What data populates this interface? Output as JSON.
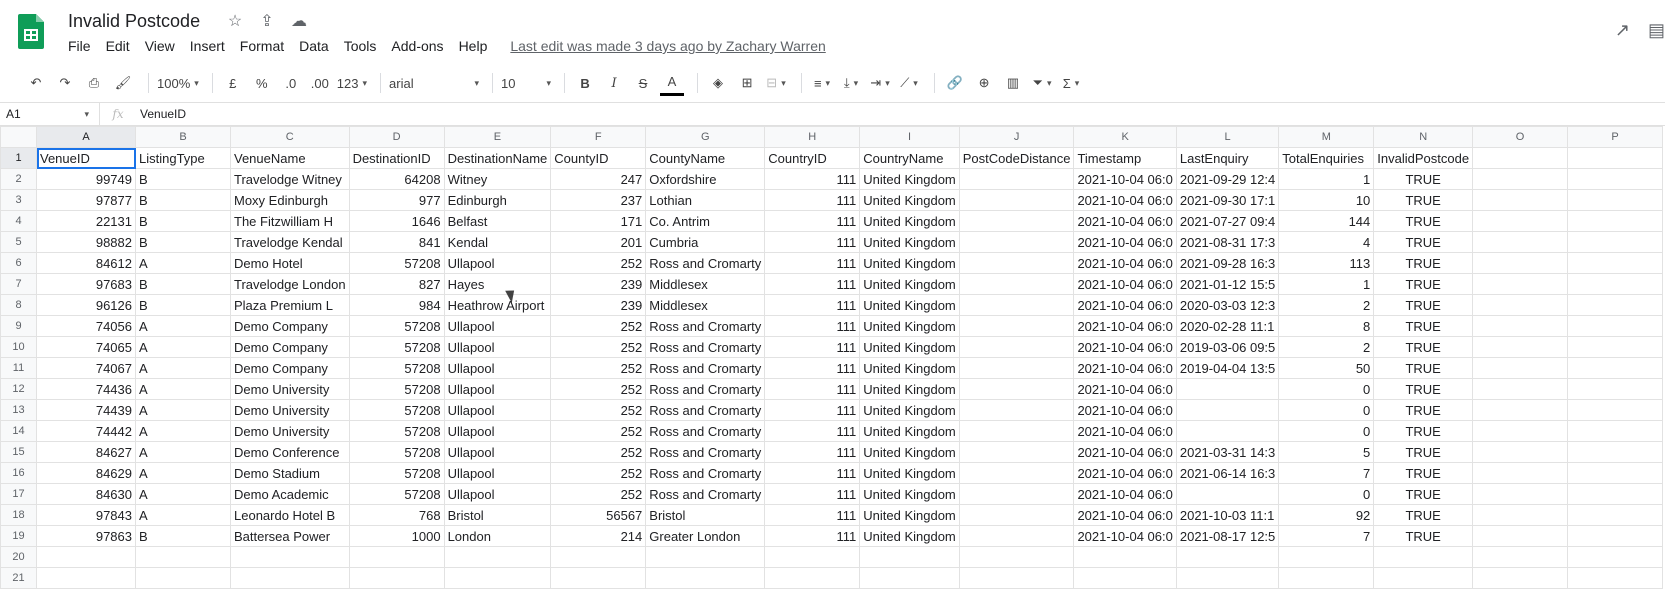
{
  "doc": {
    "title": "Invalid Postcode"
  },
  "menu": {
    "items": [
      "File",
      "Edit",
      "View",
      "Insert",
      "Format",
      "Data",
      "Tools",
      "Add-ons",
      "Help"
    ],
    "last_edit": "Last edit was made 3 days ago by Zachary Warren"
  },
  "toolbar": {
    "zoom": "100%",
    "currency": "£",
    "percent": "%",
    "dec_dec": ".0",
    "dec_inc": ".00",
    "more_formats": "123",
    "font": "arial",
    "font_size": "10"
  },
  "formula_bar": {
    "cell_ref": "A1",
    "value": "VenueID"
  },
  "colors": {
    "brand_green": "#0f9d58",
    "selection": "#1a73e8"
  },
  "sheet": {
    "columns": [
      "A",
      "B",
      "C",
      "D",
      "E",
      "F",
      "G",
      "H",
      "I",
      "J",
      "K",
      "L",
      "M",
      "N",
      "O",
      "P"
    ],
    "row_numbers": [
      "1",
      "2",
      "3",
      "4",
      "5",
      "6",
      "7",
      "8",
      "9",
      "10",
      "11",
      "12",
      "13",
      "14",
      "15",
      "16",
      "17",
      "18",
      "19",
      "20",
      "21"
    ],
    "header": [
      "VenueID",
      "ListingType",
      "VenueName",
      "DestinationID",
      "DestinationName",
      "CountyID",
      "CountyName",
      "CountryID",
      "CountryName",
      "PostCodeDistance",
      "Timestamp",
      "LastEnquiry",
      "TotalEnquiries",
      "InvalidPostcode",
      "",
      ""
    ],
    "rows": [
      [
        "99749",
        "B",
        "Travelodge Witney",
        "64208",
        "Witney",
        "247",
        "Oxfordshire",
        "111",
        "United Kingdom",
        "",
        "2021-10-04 06:0",
        "2021-09-29 12:4",
        "1",
        "TRUE",
        "",
        ""
      ],
      [
        "97877",
        "B",
        "Moxy Edinburgh",
        "977",
        "Edinburgh",
        "237",
        "Lothian",
        "111",
        "United Kingdom",
        "",
        "2021-10-04 06:0",
        "2021-09-30 17:1",
        "10",
        "TRUE",
        "",
        ""
      ],
      [
        "22131",
        "B",
        "The Fitzwilliam H",
        "1646",
        "Belfast",
        "171",
        "Co. Antrim",
        "111",
        "United Kingdom",
        "",
        "2021-10-04 06:0",
        "2021-07-27 09:4",
        "144",
        "TRUE",
        "",
        ""
      ],
      [
        "98882",
        "B",
        "Travelodge Kendal",
        "841",
        "Kendal",
        "201",
        "Cumbria",
        "111",
        "United Kingdom",
        "",
        "2021-10-04 06:0",
        "2021-08-31 17:3",
        "4",
        "TRUE",
        "",
        ""
      ],
      [
        "84612",
        "A",
        "Demo Hotel",
        "57208",
        "Ullapool",
        "252",
        "Ross and Cromarty",
        "111",
        "United Kingdom",
        "",
        "2021-10-04 06:0",
        "2021-09-28 16:3",
        "113",
        "TRUE",
        "",
        ""
      ],
      [
        "97683",
        "B",
        "Travelodge London",
        "827",
        "Hayes",
        "239",
        "Middlesex",
        "111",
        "United Kingdom",
        "",
        "2021-10-04 06:0",
        "2021-01-12 15:5",
        "1",
        "TRUE",
        "",
        ""
      ],
      [
        "96126",
        "B",
        "Plaza Premium L",
        "984",
        "Heathrow Airport",
        "239",
        "Middlesex",
        "111",
        "United Kingdom",
        "",
        "2021-10-04 06:0",
        "2020-03-03 12:3",
        "2",
        "TRUE",
        "",
        ""
      ],
      [
        "74056",
        "A",
        "Demo Company",
        "57208",
        "Ullapool",
        "252",
        "Ross and Cromarty",
        "111",
        "United Kingdom",
        "",
        "2021-10-04 06:0",
        "2020-02-28 11:1",
        "8",
        "TRUE",
        "",
        ""
      ],
      [
        "74065",
        "A",
        "Demo Company",
        "57208",
        "Ullapool",
        "252",
        "Ross and Cromarty",
        "111",
        "United Kingdom",
        "",
        "2021-10-04 06:0",
        "2019-03-06 09:5",
        "2",
        "TRUE",
        "",
        ""
      ],
      [
        "74067",
        "A",
        "Demo Company",
        "57208",
        "Ullapool",
        "252",
        "Ross and Cromarty",
        "111",
        "United Kingdom",
        "",
        "2021-10-04 06:0",
        "2019-04-04 13:5",
        "50",
        "TRUE",
        "",
        ""
      ],
      [
        "74436",
        "A",
        "Demo University",
        "57208",
        "Ullapool",
        "252",
        "Ross and Cromarty",
        "111",
        "United Kingdom",
        "",
        "2021-10-04 06:0",
        "",
        "0",
        "TRUE",
        "",
        ""
      ],
      [
        "74439",
        "A",
        "Demo University",
        "57208",
        "Ullapool",
        "252",
        "Ross and Cromarty",
        "111",
        "United Kingdom",
        "",
        "2021-10-04 06:0",
        "",
        "0",
        "TRUE",
        "",
        ""
      ],
      [
        "74442",
        "A",
        "Demo University",
        "57208",
        "Ullapool",
        "252",
        "Ross and Cromarty",
        "111",
        "United Kingdom",
        "",
        "2021-10-04 06:0",
        "",
        "0",
        "TRUE",
        "",
        ""
      ],
      [
        "84627",
        "A",
        "Demo Conference",
        "57208",
        "Ullapool",
        "252",
        "Ross and Cromarty",
        "111",
        "United Kingdom",
        "",
        "2021-10-04 06:0",
        "2021-03-31 14:3",
        "5",
        "TRUE",
        "",
        ""
      ],
      [
        "84629",
        "A",
        "Demo Stadium",
        "57208",
        "Ullapool",
        "252",
        "Ross and Cromarty",
        "111",
        "United Kingdom",
        "",
        "2021-10-04 06:0",
        "2021-06-14 16:3",
        "7",
        "TRUE",
        "",
        ""
      ],
      [
        "84630",
        "A",
        "Demo Academic",
        "57208",
        "Ullapool",
        "252",
        "Ross and Cromarty",
        "111",
        "United Kingdom",
        "",
        "2021-10-04 06:0",
        "",
        "0",
        "TRUE",
        "",
        ""
      ],
      [
        "97843",
        "A",
        "Leonardo Hotel B",
        "768",
        "Bristol",
        "56567",
        "Bristol",
        "111",
        "United Kingdom",
        "",
        "2021-10-04 06:0",
        "2021-10-03 11:1",
        "92",
        "TRUE",
        "",
        ""
      ],
      [
        "97863",
        "B",
        "Battersea Power",
        "1000",
        "London",
        "214",
        "Greater London",
        "111",
        "United Kingdom",
        "",
        "2021-10-04 06:0",
        "2021-08-17 12:5",
        "7",
        "TRUE",
        "",
        ""
      ],
      [
        "",
        "",
        "",
        "",
        "",
        "",
        "",
        "",
        "",
        "",
        "",
        "",
        "",
        "",
        "",
        ""
      ],
      [
        "",
        "",
        "",
        "",
        "",
        "",
        "",
        "",
        "",
        "",
        "",
        "",
        "",
        "",
        "",
        ""
      ]
    ]
  }
}
